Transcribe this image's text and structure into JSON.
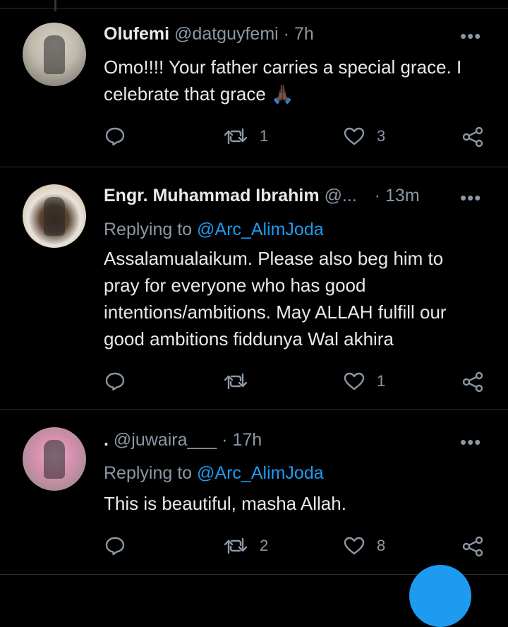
{
  "tweets": [
    {
      "name": "Olufemi",
      "handle": "@datguyfemi",
      "sep": "·",
      "time": "7h",
      "replying_prefix": "",
      "replying_to": "",
      "text_lines": [
        "Omo!!!! Your father carries a special grace. I",
        "celebrate that grace 🙏🏿"
      ],
      "reply_count": "",
      "retweet_count": "1",
      "like_count": "3",
      "avatar": "avatar-child-photo"
    },
    {
      "name": "Engr. Muhammad Ibrahim",
      "handle": "@...",
      "sep": "·",
      "time": "13m",
      "replying_prefix": "Replying to",
      "replying_to": "@Arc_AlimJoda",
      "text_lines": [
        "Assalamualaikum. Please also beg him to",
        "pray for everyone who has good",
        "intentions/ambitions. May ALLAH fulfill our",
        "good ambitions fiddunya Wal akhira"
      ],
      "reply_count": "",
      "retweet_count": "",
      "like_count": "1",
      "avatar": "avatar-man-cap-photo"
    },
    {
      "name": ".",
      "handle": "@juwaira___",
      "sep": "·",
      "time": "17h",
      "replying_prefix": "Replying to",
      "replying_to": "@Arc_AlimJoda",
      "text_lines": [
        "This is beautiful, masha Allah."
      ],
      "reply_count": "",
      "retweet_count": "2",
      "like_count": "8",
      "avatar": "avatar-woman-photo"
    }
  ],
  "icons": {
    "reply": "reply-icon",
    "retweet": "retweet-icon",
    "like": "like-icon",
    "share": "share-icon",
    "more": "more-icon"
  },
  "more_glyph": "•••",
  "colors": {
    "background": "#000000",
    "text": "#e7e9ea",
    "muted": "#8b98a5",
    "accent": "#1d9bf0",
    "divider": "#2f3336"
  }
}
